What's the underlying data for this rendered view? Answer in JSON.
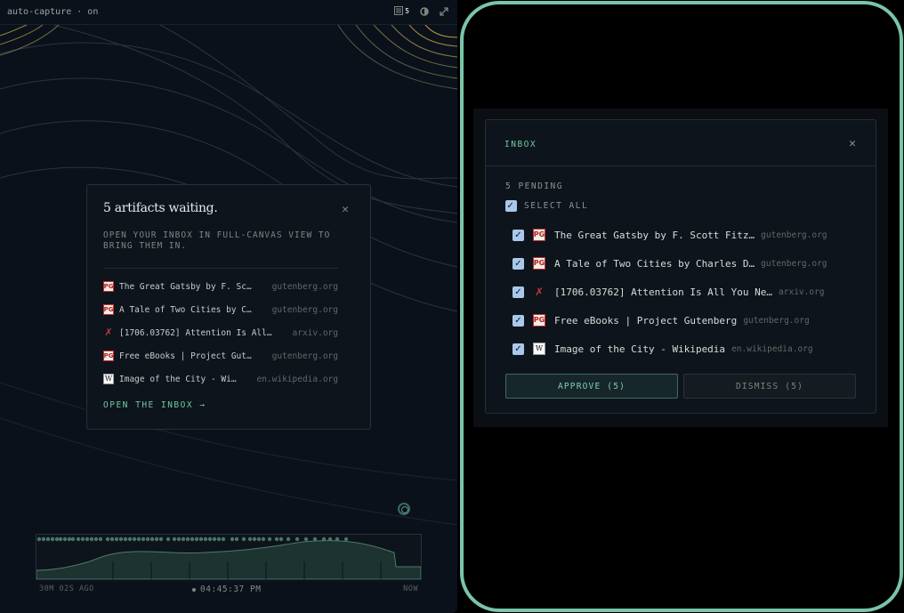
{
  "topbar": {
    "status": "auto-capture · on",
    "inbox_count": "5",
    "icons": [
      "inbox-icon",
      "contrast-icon",
      "expand-icon"
    ]
  },
  "notice": {
    "title": "5 artifacts waiting.",
    "subtitle": "OPEN YOUR INBOX IN FULL-CANVAS VIEW TO BRING THEM IN.",
    "items": [
      {
        "title": "The Great Gatsby by F. Sc…",
        "domain": "gutenberg.org",
        "icon": "gutenberg"
      },
      {
        "title": "A Tale of Two Cities by C…",
        "domain": "gutenberg.org",
        "icon": "gutenberg"
      },
      {
        "title": "[1706.03762] Attention Is All…",
        "domain": "arxiv.org",
        "icon": "arxiv"
      },
      {
        "title": "Free eBooks | Project Gut…",
        "domain": "gutenberg.org",
        "icon": "gutenberg"
      },
      {
        "title": "Image of the City - Wi…",
        "domain": "en.wikipedia.org",
        "icon": "wikipedia"
      }
    ],
    "open_link": "OPEN THE INBOX →"
  },
  "timeline": {
    "start_label": "30M 02S AGO",
    "current_time": "04:45:37 PM",
    "end_label": "NOW"
  },
  "inbox": {
    "header": "INBOX",
    "pending_label": "5 PENDING",
    "select_all_label": "SELECT ALL",
    "select_all_checked": true,
    "items": [
      {
        "title": "The Great Gatsby by F. Scott Fitz…",
        "domain": "gutenberg.org",
        "icon": "gutenberg",
        "checked": true
      },
      {
        "title": "A Tale of Two Cities by Charles D…",
        "domain": "gutenberg.org",
        "icon": "gutenberg",
        "checked": true
      },
      {
        "title": "[1706.03762] Attention Is All You Ne…",
        "domain": "arxiv.org",
        "icon": "arxiv",
        "checked": true
      },
      {
        "title": "Free eBooks | Project Gutenberg",
        "domain": "gutenberg.org",
        "icon": "gutenberg",
        "checked": true
      },
      {
        "title": "Image of the City - Wikipedia",
        "domain": "en.wikipedia.org",
        "icon": "wikipedia",
        "checked": true
      }
    ],
    "approve_label": "APPROVE (5)",
    "dismiss_label": "DISMISS (5)"
  },
  "colors": {
    "accent": "#6fc7a5",
    "frame_border": "#79c5a8",
    "checkbox": "#a9c8ec",
    "background": "#0b111b"
  }
}
